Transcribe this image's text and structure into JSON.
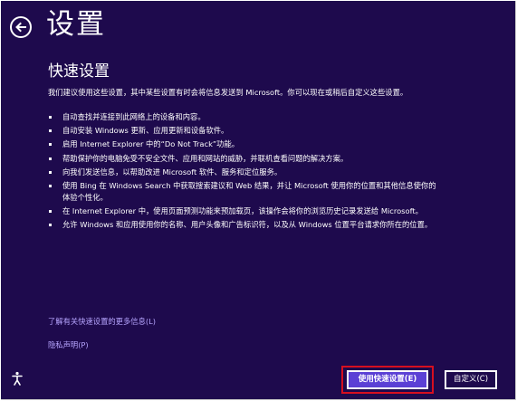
{
  "header": {
    "title": "设置",
    "back_icon": "back-arrow-icon"
  },
  "content": {
    "section_title": "快速设置",
    "intro": "我们建议使用这些设置，其中某些设置有时会将信息发送到 Microsoft。你可以现在或稍后自定义这些设置。",
    "bullets": [
      "自动查找并连接到此网络上的设备和内容。",
      "自动安装 Windows 更新、应用更新和设备软件。",
      "启用 Internet Explorer 中的“Do Not Track”功能。",
      "帮助保护你的电脑免受不安全文件、应用和网站的威胁，并联机查看问题的解决方案。",
      "向我们发送信息，以帮助改进 Microsoft 软件、服务和定位服务。",
      "使用 Bing 在 Windows Search 中获取搜索建议和 Web 结果，并让 Microsoft 使用你的位置和其他信息使你的\n体验个性化。",
      "在 Internet Explorer 中，使用页面预测功能来预加载页，该操作会将你的浏览历史记录发送给 Microsoft。",
      "允许 Windows 和应用使用你的名称、用户头像和广告标识符，以及从 Windows 位置平台请求你所在的位置。"
    ]
  },
  "links": {
    "learn_more": "了解有关快速设置的更多信息(L)",
    "privacy": "隐私声明(P)"
  },
  "footer": {
    "ease_of_access_icon": "ease-of-access-icon",
    "express_button": "使用快速设置(E)",
    "customize_button": "自定义(C)"
  },
  "colors": {
    "background": "#1e0a4d",
    "accent_button": "#5b40d5",
    "link": "#b7a5ff",
    "highlight": "#d60f1f"
  }
}
